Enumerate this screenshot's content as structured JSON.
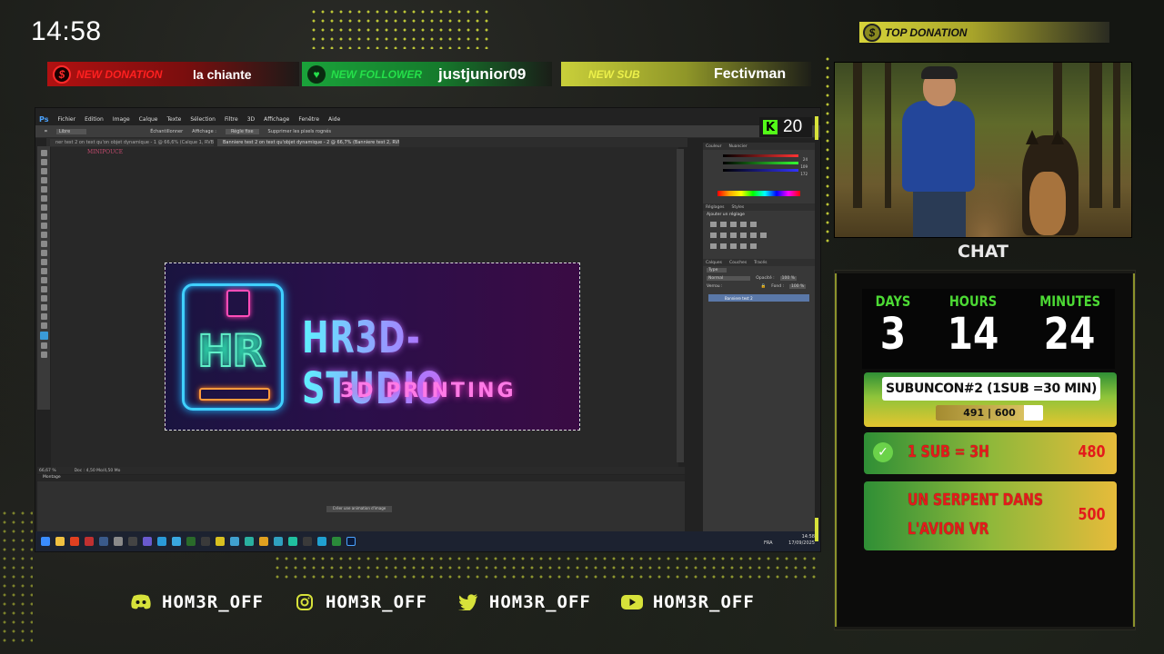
{
  "clock": "14:58",
  "alerts": {
    "donation": {
      "tag": "NEW DONATION",
      "value": "la chiante",
      "icon": "dollar-icon"
    },
    "follower": {
      "tag": "NEW FOLLOWER",
      "value": "justjunior09",
      "icon": "heart-icon"
    },
    "sub": {
      "tag": "NEW SUB",
      "value": "Fectivman"
    }
  },
  "top_donation": {
    "label": "TOP DONATION",
    "icon": "dollar-icon"
  },
  "photoshop": {
    "logo": "Ps",
    "menu": [
      "Fichier",
      "Edition",
      "Image",
      "Calque",
      "Texte",
      "Sélection",
      "Filtre",
      "3D",
      "Affichage",
      "Fenêtre",
      "Aide"
    ],
    "options": [
      "Libre",
      "Échantillonner",
      "Affichage :",
      "Règle fixe",
      "Supprimer les pixels rognés"
    ],
    "doc_tabs": [
      "ner test 2 on text qu'on objet dynamique - 1 @ 66,6% (Calque 1, RVB/8)",
      "Banniere test 2 on text qu'objet dynamique - 2 @ 66,7% (Banniere test 2, RVB/8)"
    ],
    "doc_watermark": "MINIPOUCE",
    "banner": {
      "mark": "HR",
      "title": "HR3D-STUDIO",
      "subtitle": "3D PRINTING"
    },
    "panels": {
      "color_tabs": [
        "Couleur",
        "Nuancier"
      ],
      "color_values": [
        "24",
        "109",
        "172"
      ],
      "adjust_tabs": [
        "Réglages",
        "Styles"
      ],
      "adjust_title": "Ajouter un réglage",
      "layer_tabs": [
        "Calques",
        "Couches",
        "Tracés"
      ],
      "layer_kind": "Type",
      "blend_mode": "Normal",
      "opacity_label": "Opacité :",
      "opacity_value": "100 %",
      "lock_label": "Verrou :",
      "fill_label": "Fond :",
      "fill_value": "100 %",
      "layer_name": "Banniere test 2"
    },
    "status": {
      "zoom": "66,67 %",
      "doc": "Doc : 4,50 Mo/4,50 Mo"
    },
    "anim_title": "Montage",
    "anim_button": "Créer une animation d'image",
    "taskbar": {
      "lang": "FRA",
      "time": "14:58",
      "date": "17/09/2025"
    }
  },
  "kick_counter": {
    "icon": "K",
    "value": "20"
  },
  "chat_label": "CHAT",
  "subathon": {
    "days_label": "DAYS",
    "days": "3",
    "hours_label": "HOURS",
    "hours": "14",
    "minutes_label": "MINUTES",
    "minutes": "24",
    "goal_title": "SUBUNCON#2 (1SUB =30 MIN)",
    "goal_current": 491,
    "goal_max": 600,
    "goal_text": "491 | 600",
    "rows": [
      {
        "label": "1 SUB = 3H",
        "points": "480",
        "done": true
      },
      {
        "label": "UN SERPENT DANS",
        "label2": "L'AVION VR",
        "points": "500",
        "done": false
      }
    ]
  },
  "socials": [
    {
      "icon": "discord-icon",
      "handle": "HOM3R_OFF"
    },
    {
      "icon": "instagram-icon",
      "handle": "HOM3R_OFF"
    },
    {
      "icon": "twitter-icon",
      "handle": "HOM3R_OFF"
    },
    {
      "icon": "youtube-icon",
      "handle": "HOM3R_OFF"
    }
  ],
  "colors": {
    "accent_yellow": "#d7e23a",
    "green": "#4cd934",
    "red": "#e31b1b",
    "kick_green": "#53fc18"
  }
}
